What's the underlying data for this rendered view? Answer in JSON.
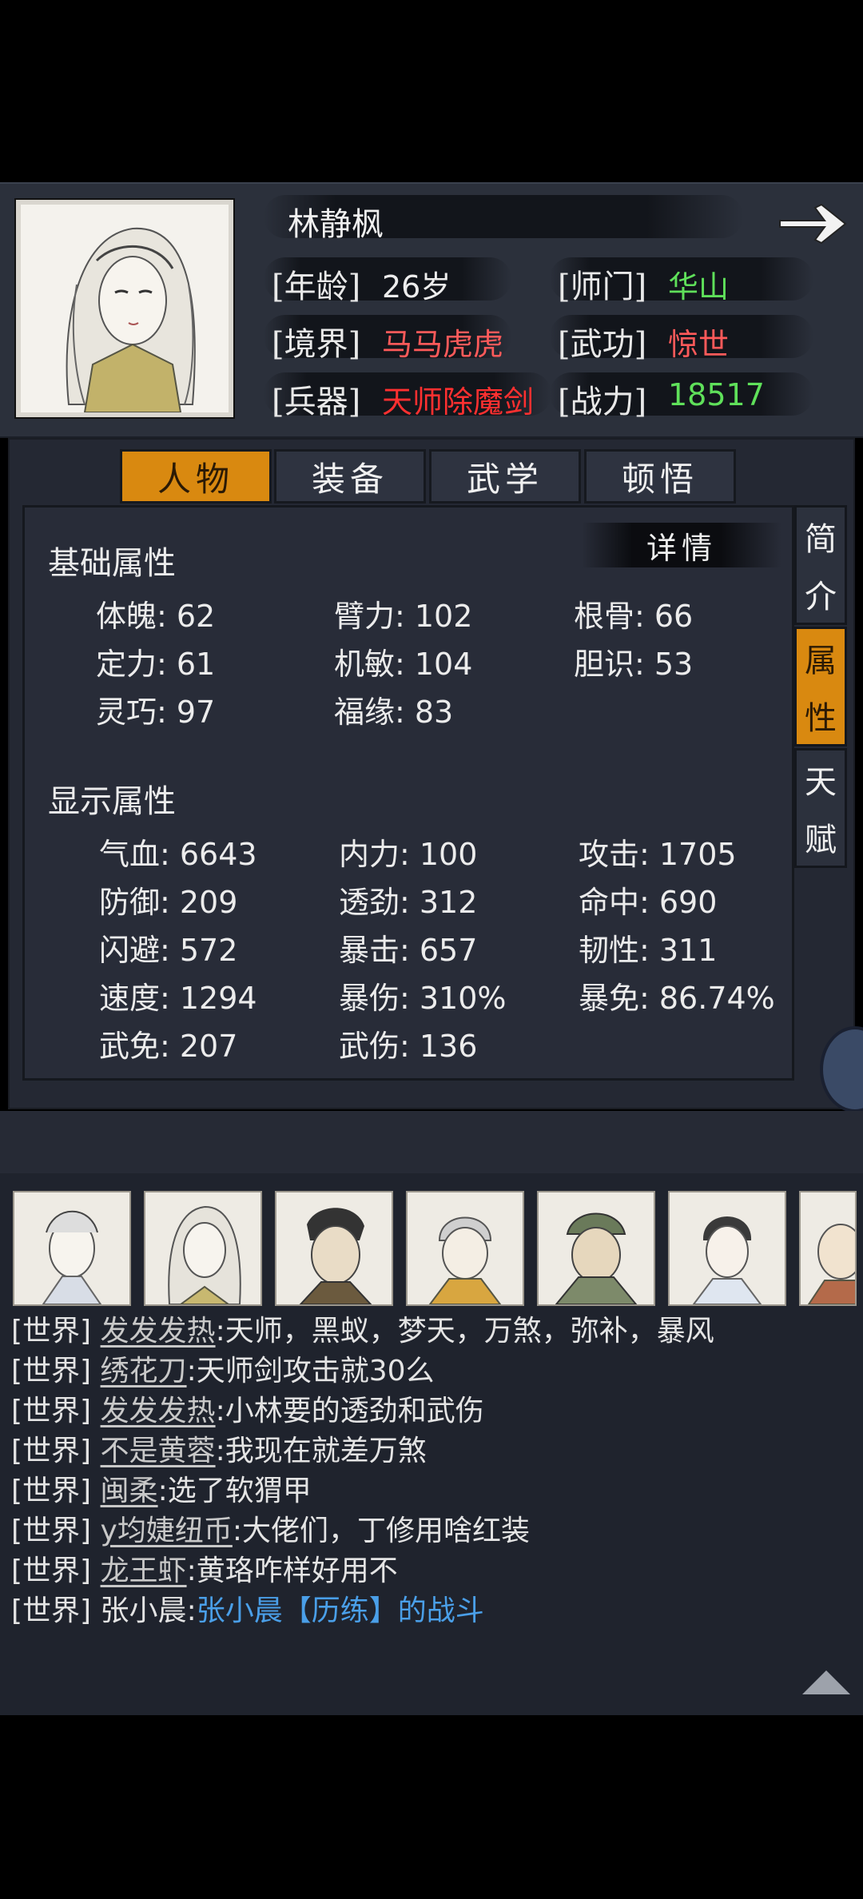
{
  "character": {
    "name": "林静枫",
    "age_label": "[年龄]",
    "age": "26岁",
    "sect_label": "[师门]",
    "sect": "华山",
    "realm_label": "[境界]",
    "realm": "马马虎虎",
    "martial_label": "[武功]",
    "martial": "惊世",
    "weapon_label": "[兵器]",
    "weapon": "天师除魔剑",
    "power_label": "[战力]",
    "power": "18517"
  },
  "tabs": [
    "人物",
    "装备",
    "武学",
    "顿悟"
  ],
  "side_tabs": {
    "intro": [
      "简",
      "介"
    ],
    "attributes": [
      "属",
      "性"
    ],
    "talent": [
      "天",
      "赋"
    ]
  },
  "detail_button": "详情",
  "basic": {
    "title": "基础属性",
    "rows": [
      [
        "体魄: 62",
        "臂力: 102",
        "根骨: 66"
      ],
      [
        "定力: 61",
        "机敏: 104",
        "胆识: 53"
      ],
      [
        "灵巧: 97",
        "福缘: 83",
        ""
      ]
    ]
  },
  "display": {
    "title": "显示属性",
    "rows": [
      [
        "气血: 6643",
        "内力: 100",
        "攻击: 1705"
      ],
      [
        "防御: 209",
        "透劲: 312",
        "命中: 690"
      ],
      [
        "闪避: 572",
        "暴击: 657",
        "韧性: 311"
      ],
      [
        "速度: 1294",
        "暴伤: 310%",
        "暴免: 86.74%"
      ],
      [
        "武免: 207",
        "武伤: 136",
        ""
      ]
    ]
  },
  "chat": [
    {
      "channel": "[世界]",
      "user": "发发发热",
      "text": ":天师，黑蚁，梦天，万煞，弥补，暴风"
    },
    {
      "channel": "[世界]",
      "user": "绣花刀",
      "text": ":天师剑攻击就30么"
    },
    {
      "channel": "[世界]",
      "user": "发发发热",
      "text": ":小林要的透劲和武伤"
    },
    {
      "channel": "[世界]",
      "user": "不是黄蓉",
      "text": ":我现在就差万煞"
    },
    {
      "channel": "[世界]",
      "user": "闽柔",
      "text": ":选了软猬甲"
    },
    {
      "channel": "[世界]",
      "user": "y均婕纽币",
      "text": ":大佬们，丁修用啥红装"
    },
    {
      "channel": "[世界]",
      "user": "龙王虾",
      "text": ":黄珞咋样好用不"
    }
  ],
  "chat_last": {
    "channel": "[世界]",
    "user": "张小晨",
    "sep": ":",
    "link": "张小晨【历练】的战斗"
  }
}
